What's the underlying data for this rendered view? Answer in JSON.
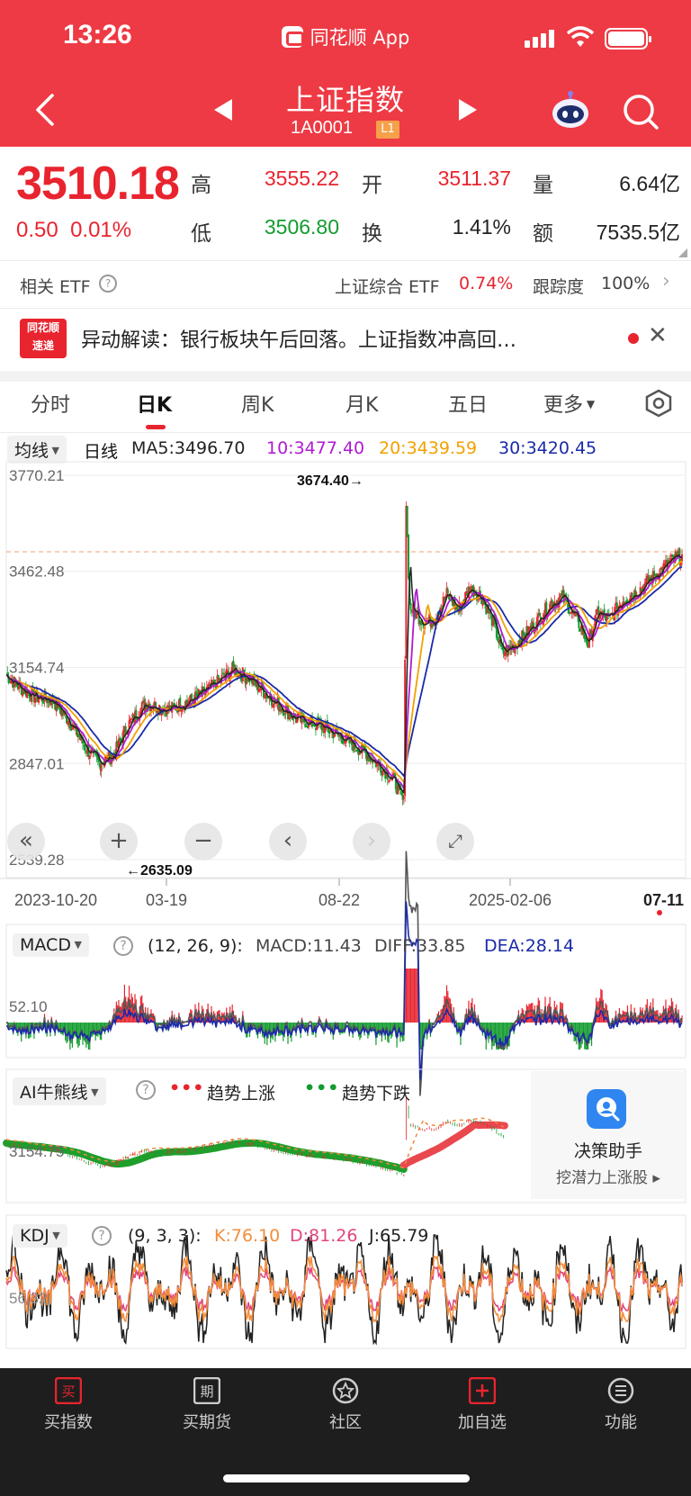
{
  "status": {
    "time": "13:26",
    "app_name": "同花顺 App"
  },
  "nav": {
    "title": "上证指数",
    "code": "1A0001",
    "level": "L1"
  },
  "quote": {
    "price": "3510.18",
    "change": "0.50",
    "change_pct": "0.01%",
    "high_label": "高",
    "high": "3555.22",
    "open_label": "开",
    "open": "3511.37",
    "vol_label": "量",
    "vol": "6.64亿",
    "low_label": "低",
    "low": "3506.80",
    "turn_label": "换",
    "turn": "1.41%",
    "amt_label": "额",
    "amt": "7535.5亿"
  },
  "etf": {
    "label": "相关 ETF",
    "name": "上证综合 ETF",
    "pct": "0.74%",
    "track_label": "跟踪度",
    "track": "100%"
  },
  "news": {
    "logo_top": "同花顺",
    "logo_bottom": "速递",
    "text": "异动解读：银行板块午后回落。上证指数冲高回…"
  },
  "tabs": [
    "分时",
    "日K",
    "周K",
    "月K",
    "五日",
    "更多"
  ],
  "active_tab": "日K",
  "ma": {
    "selector": "均线",
    "period": "日线",
    "ma5": "MA5:3496.70",
    "ma10": "10:3477.40",
    "ma20": "20:3439.59",
    "ma30": "30:3420.45"
  },
  "colors": {
    "up": "#e8242e",
    "down": "#129c2e",
    "ma5": "#222222",
    "ma10": "#b01bd1",
    "ma20": "#f2a100",
    "ma30": "#1a2aa8",
    "header": "#ee3a44"
  },
  "chart_data": {
    "type": "candlestick",
    "y_ticks": [
      "3770.21",
      "3462.48",
      "3154.74",
      "2847.01",
      "2539.28"
    ],
    "ylim": [
      2539.28,
      3770.21
    ],
    "x_ticks": [
      "2023-10-20",
      "03-19",
      "08-22",
      "2025-02-06",
      "07-11"
    ],
    "annotations": {
      "high": "3674.40→",
      "low": "←2635.09"
    },
    "close_path": [
      [
        0,
        3130
      ],
      [
        12,
        3090
      ],
      [
        25,
        3060
      ],
      [
        40,
        3050
      ],
      [
        55,
        2980
      ],
      [
        70,
        2890
      ],
      [
        80,
        2850
      ],
      [
        92,
        2870
      ],
      [
        105,
        2970
      ],
      [
        120,
        3040
      ],
      [
        140,
        3020
      ],
      [
        160,
        3050
      ],
      [
        180,
        3100
      ],
      [
        196,
        3150
      ],
      [
        210,
        3120
      ],
      [
        230,
        3050
      ],
      [
        250,
        2990
      ],
      [
        270,
        2970
      ],
      [
        290,
        2930
      ],
      [
        310,
        2880
      ],
      [
        325,
        2830
      ],
      [
        335,
        2790
      ],
      [
        343,
        2720
      ],
      [
        345,
        3680
      ],
      [
        348,
        3350
      ],
      [
        360,
        3300
      ],
      [
        370,
        3310
      ],
      [
        380,
        3390
      ],
      [
        390,
        3340
      ],
      [
        400,
        3410
      ],
      [
        410,
        3380
      ],
      [
        420,
        3300
      ],
      [
        428,
        3200
      ],
      [
        440,
        3230
      ],
      [
        455,
        3290
      ],
      [
        470,
        3360
      ],
      [
        480,
        3380
      ],
      [
        492,
        3310
      ],
      [
        502,
        3230
      ],
      [
        510,
        3330
      ],
      [
        520,
        3310
      ],
      [
        532,
        3370
      ],
      [
        545,
        3400
      ],
      [
        560,
        3450
      ],
      [
        575,
        3500
      ],
      [
        583,
        3510
      ]
    ]
  },
  "macd": {
    "selector": "MACD",
    "params": "(12, 26, 9):",
    "macd": "MACD:11.43",
    "diff": "DIFF:33.85",
    "dea": "DEA:28.14",
    "level": "52.10"
  },
  "ai": {
    "selector": "AI牛熊线",
    "up_label": "趋势上涨",
    "down_label": "趋势下跌",
    "level": "3154.75",
    "panel_title": "决策助手",
    "panel_sub": "挖潜力上涨股 ▸"
  },
  "kdj": {
    "selector": "KDJ",
    "params": "(9, 3, 3):",
    "k": "K:76.10",
    "d": "D:81.26",
    "j": "J:65.79",
    "level": "56.32"
  },
  "bottom_nav": [
    "买指数",
    "买期货",
    "社区",
    "加自选",
    "功能"
  ]
}
